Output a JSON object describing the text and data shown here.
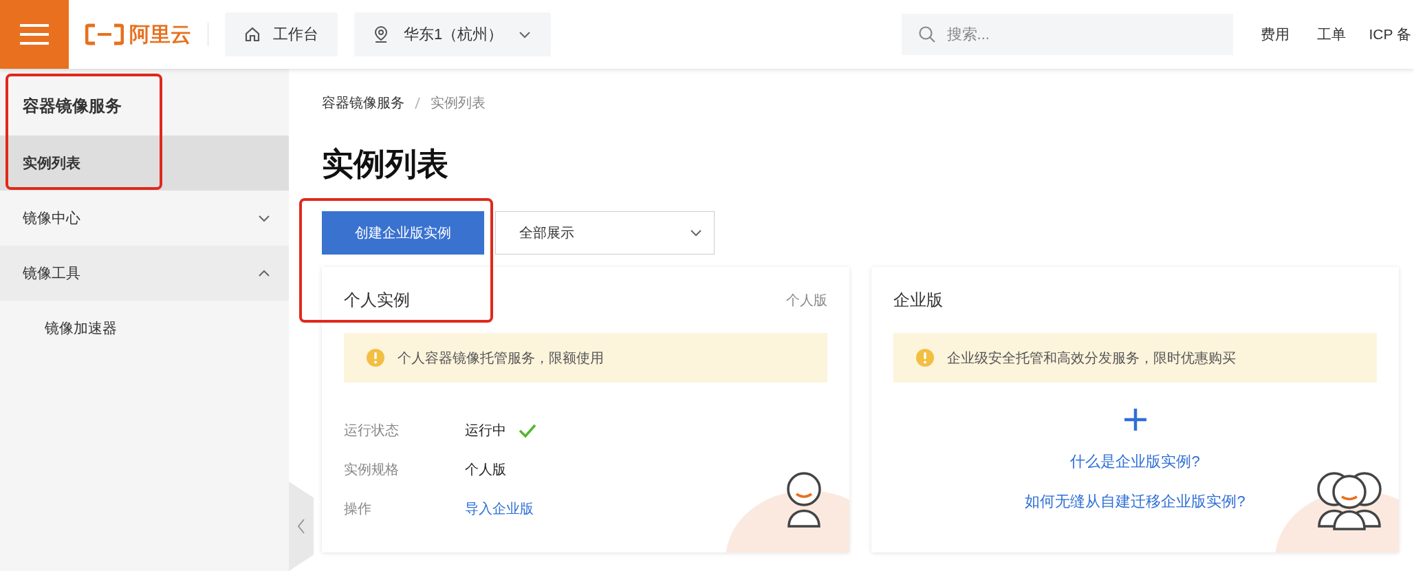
{
  "top_bar": {
    "brand": "阿里云",
    "home_button": "工作台",
    "region_select": "华东1（杭州）",
    "search": {
      "placeholder": "搜索..."
    },
    "links": [
      "费用",
      "工单",
      "ICP 备"
    ]
  },
  "sidebar": {
    "title": "容器镜像服务",
    "items": [
      {
        "kind": "link",
        "label": "实例列表",
        "selected": true
      },
      {
        "kind": "group",
        "label": "镜像中心",
        "expanded": false
      },
      {
        "kind": "group",
        "label": "镜像工具",
        "expanded": true,
        "children": [
          {
            "label": "镜像加速器",
            "selected": false
          }
        ]
      }
    ]
  },
  "breadcrumb": [
    "容器镜像服务",
    "实例列表"
  ],
  "page_title": "实例列表",
  "create_button": "创建企业版实例",
  "filter_select": "全部展示",
  "cards": [
    {
      "kind": "personal",
      "title": "个人实例",
      "tag": "个人版",
      "notice": "个人容器镜像托管服务，限额使用",
      "details": [
        {
          "kind": "status",
          "label": "运行状态",
          "value": "运行中"
        },
        {
          "kind": "text",
          "label": "实例规格",
          "value": "个人版"
        },
        {
          "kind": "link",
          "label": "操作",
          "value": "导入企业版"
        }
      ]
    },
    {
      "kind": "enterprise",
      "title": "企业版",
      "notice": "企业级安全托管和高效分发服务，限时优惠购买",
      "links": [
        "什么是企业版实例?",
        "如何无缝从自建迁移企业版实例?"
      ]
    }
  ]
}
